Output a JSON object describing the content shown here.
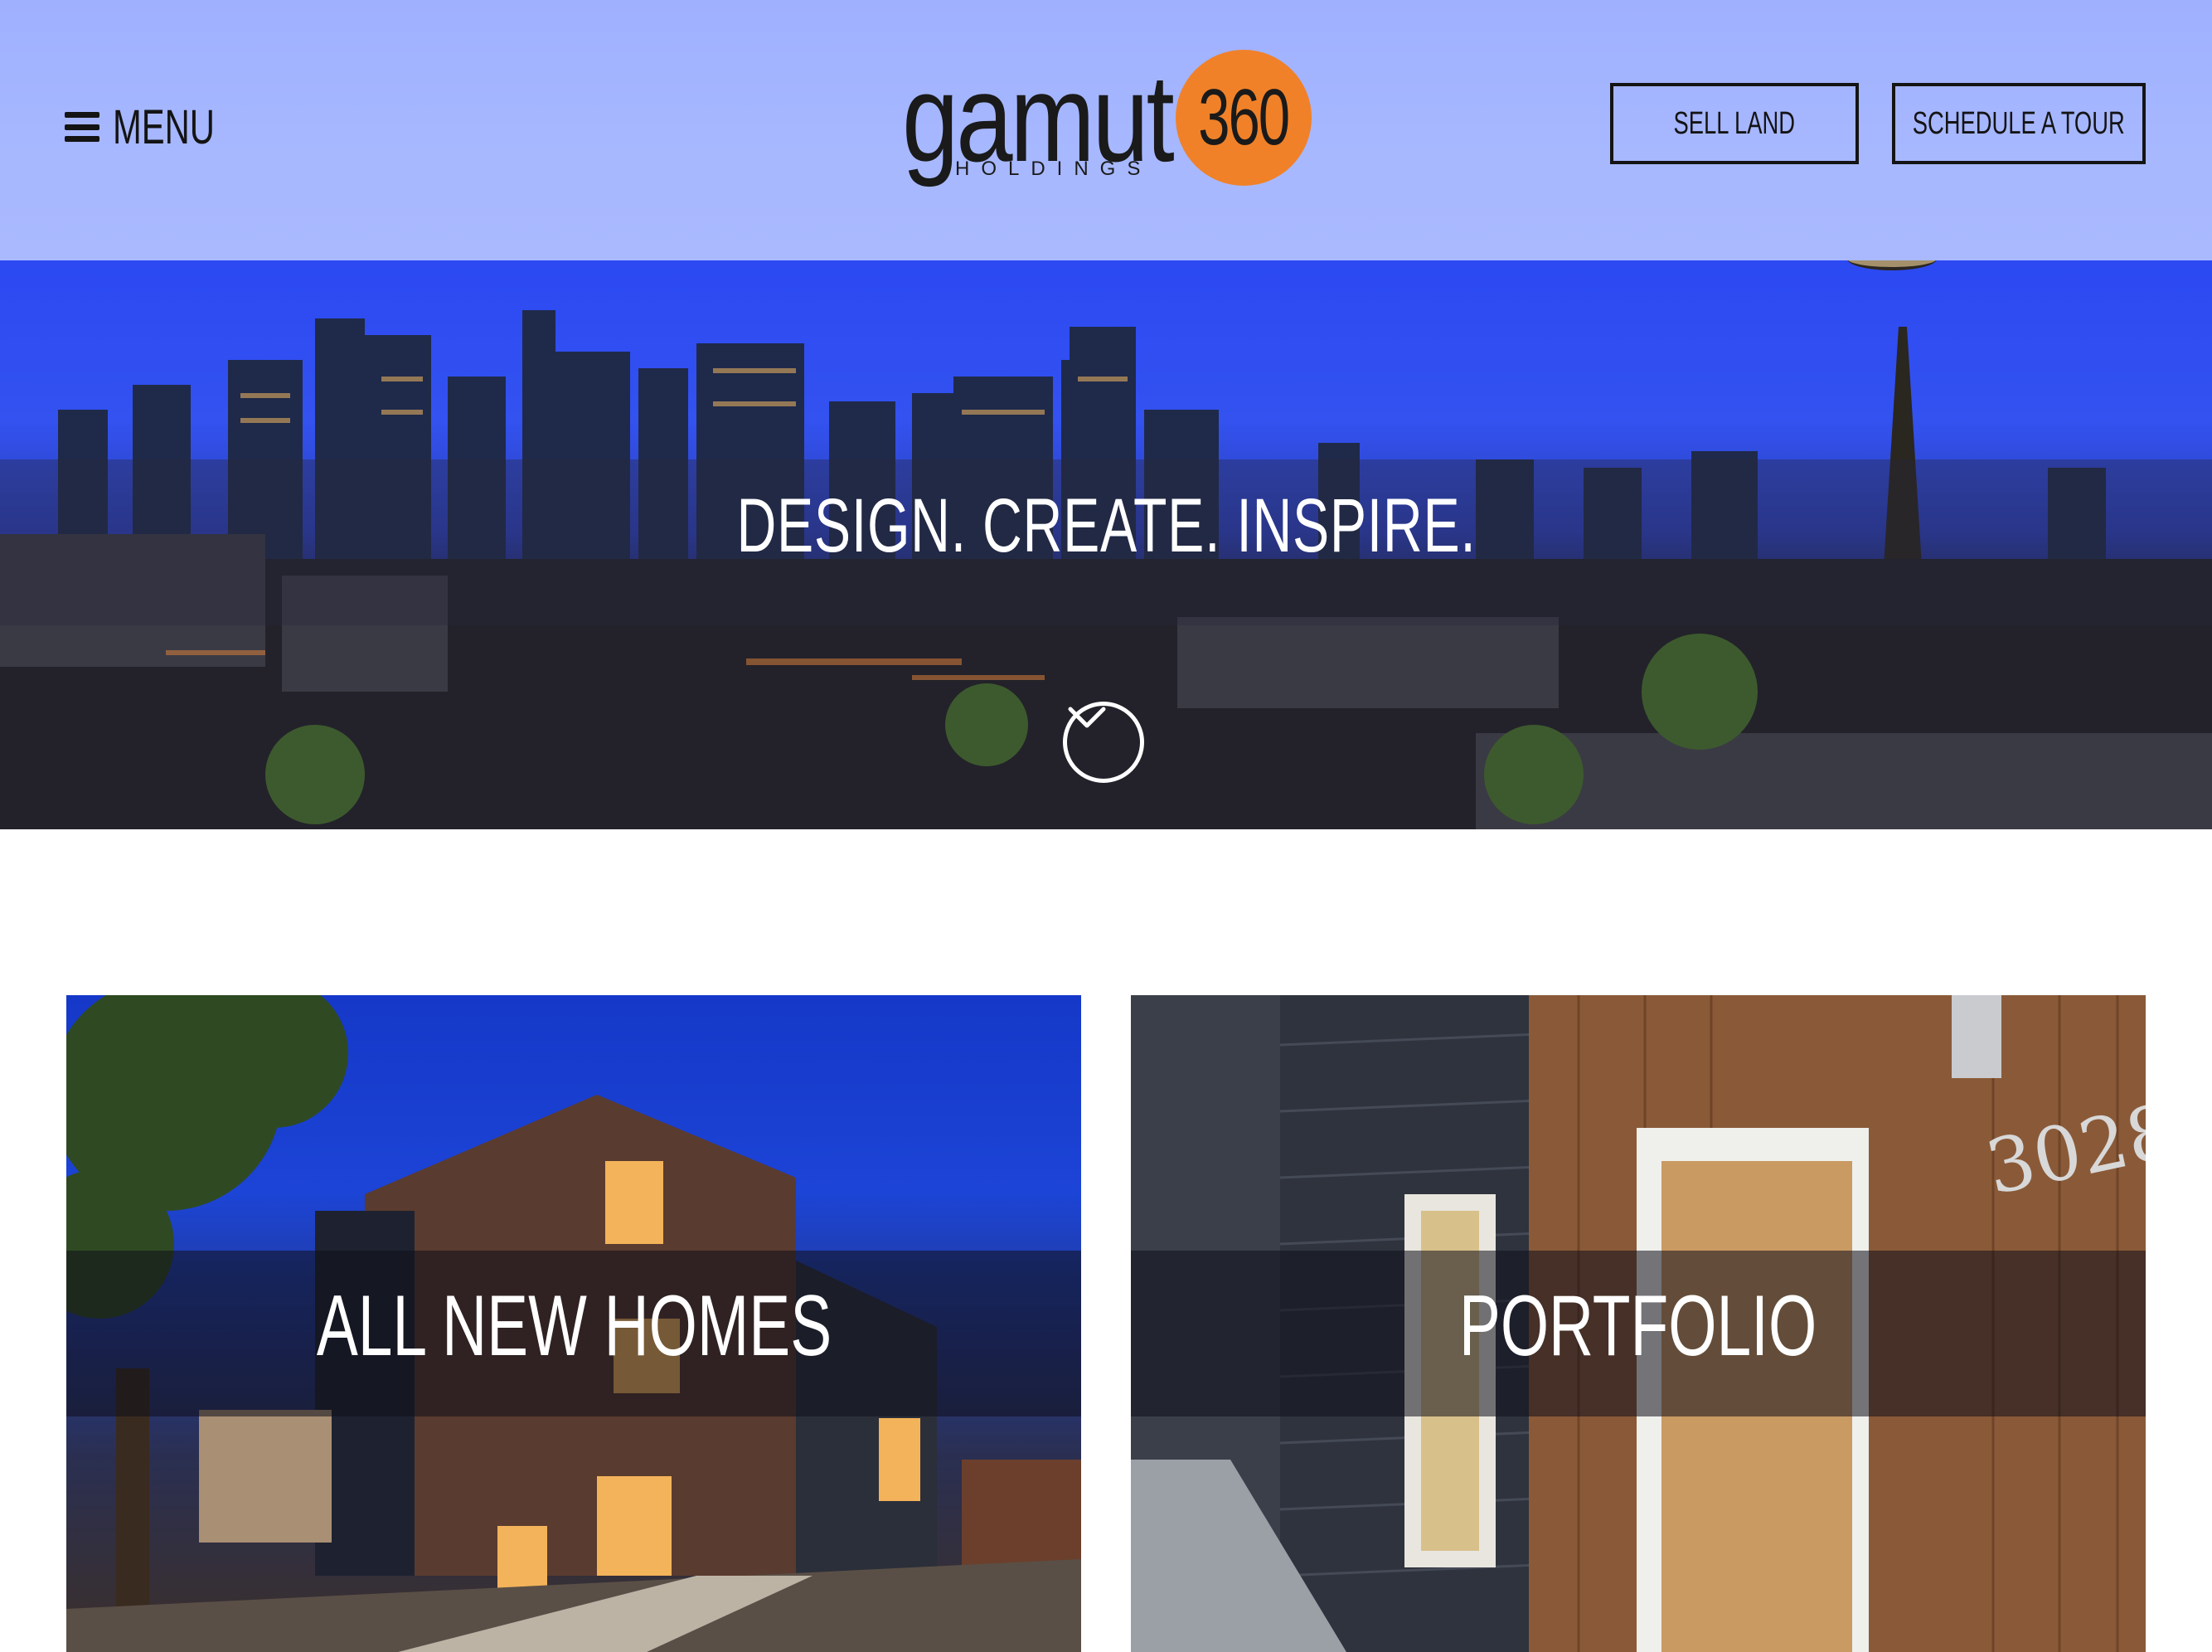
{
  "header": {
    "menu_label": "MENU",
    "logo": {
      "wordmark": "gamut",
      "number": "360",
      "subtitle": "HOLDINGS"
    },
    "buttons": {
      "sell_land": "SELL LAND",
      "schedule_tour": "SCHEDULE A TOUR"
    }
  },
  "hero": {
    "title": "DESIGN. CREATE. INSPIRE.",
    "scroll_icon": "chevron-down-circle-icon"
  },
  "cards": [
    {
      "label": "ALL NEW HOMES"
    },
    {
      "label": "PORTFOLIO",
      "house_number": "3028"
    }
  ],
  "colors": {
    "header_bg": "#a7b8ff",
    "logo_accent": "#f08128",
    "text_dark": "#141414",
    "text_light": "#ffffff"
  }
}
